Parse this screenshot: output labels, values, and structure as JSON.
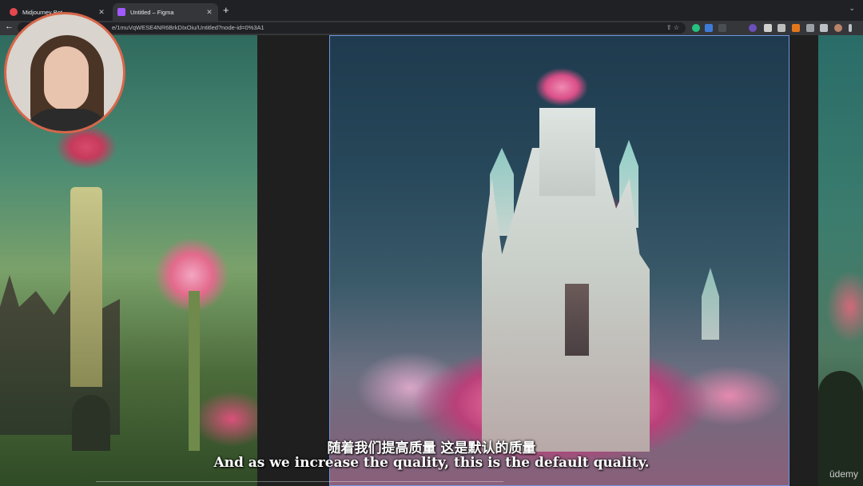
{
  "tabs": [
    {
      "title": "Midjourney Bot",
      "close": "✕",
      "favicon": "discord-icon",
      "color": "#e5484d"
    },
    {
      "title": "Untitled – Figma",
      "close": "✕",
      "favicon": "figma-icon",
      "color": "#a259ff"
    }
  ],
  "new_tab": "+",
  "tab_menu": "⌄",
  "toolbar": {
    "back": "←",
    "url": "e/1muVqWESE4NR6BrkDIxOiu/Untitled?node-id=0%3A1",
    "omni_icons": "⇧  ☆"
  },
  "subtitles": {
    "zh": "随着我们提高质量 这是默认的质量",
    "en": "And as we increase the quality, this is the default quality."
  },
  "watermark": "ûdemy",
  "colors": {
    "selection": "#6f95e0",
    "webcam_border": "#d8664a"
  }
}
